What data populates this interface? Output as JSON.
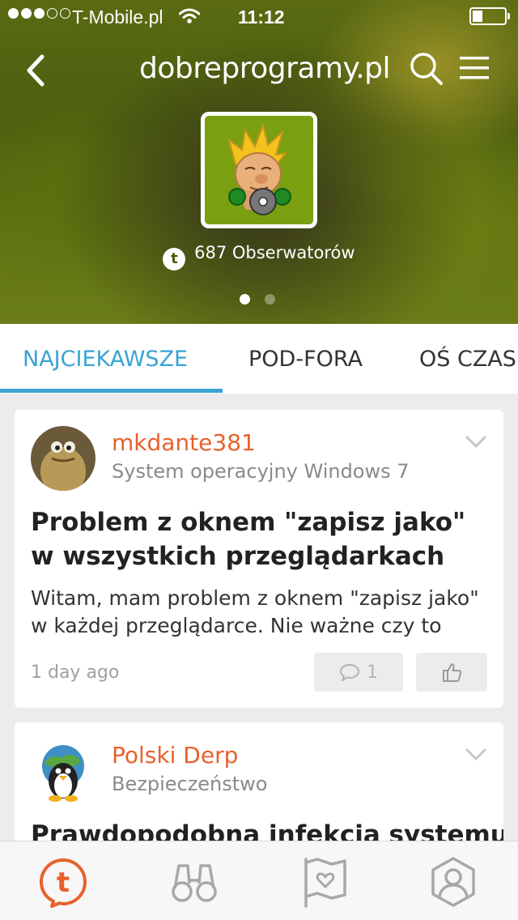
{
  "status_bar": {
    "carrier": "T-Mobile.pl",
    "time": "11:12",
    "signal_bars_filled": 3,
    "signal_bars_total": 5,
    "battery_level": 0.2
  },
  "header": {
    "title": "dobreprogramy.pl",
    "back_icon": "chevron-left-icon",
    "search_icon": "search-icon",
    "menu_icon": "hamburger-menu-icon"
  },
  "profile": {
    "followers_text": "687 Obserwatorów",
    "follower_icon": "tapatalk-icon",
    "pager": {
      "pages": 2,
      "active": 1
    },
    "avatar_bg": "#7aa011"
  },
  "tabs": [
    {
      "label": "NAJCIEKAWSZE",
      "active": true
    },
    {
      "label": "POD-FORA",
      "active": false
    },
    {
      "label": "OŚ CZAS",
      "active": false
    }
  ],
  "posts": [
    {
      "author": "mkdante381",
      "forum": "System operacyjny Windows 7",
      "title": "Problem z oknem \"zapisz jako\" w wszystkich przeglądarkach",
      "excerpt": "Witam, mam problem z oknem \"zapisz jako\" w każdej przeglądarce. Nie ważne czy to Fir…",
      "time": "1 day ago",
      "comments": "1"
    },
    {
      "author": "Polski Derp",
      "forum": "Bezpieczeństwo",
      "title": "Prawdopodobna infekcja systemu - "
    }
  ],
  "bottom_nav": [
    {
      "name": "tapatalk-home",
      "icon": "tapatalk-logo-icon",
      "active": true
    },
    {
      "name": "explore",
      "icon": "binoculars-icon",
      "active": false
    },
    {
      "name": "feed",
      "icon": "flag-heart-icon",
      "active": false
    },
    {
      "name": "profile",
      "icon": "user-profile-icon",
      "active": false
    }
  ],
  "colors": {
    "accent_blue": "#3aa3d4",
    "author_orange": "#e8612c",
    "active_nav_orange": "#e8612c",
    "inactive_nav_gray": "#a8a8a8"
  }
}
